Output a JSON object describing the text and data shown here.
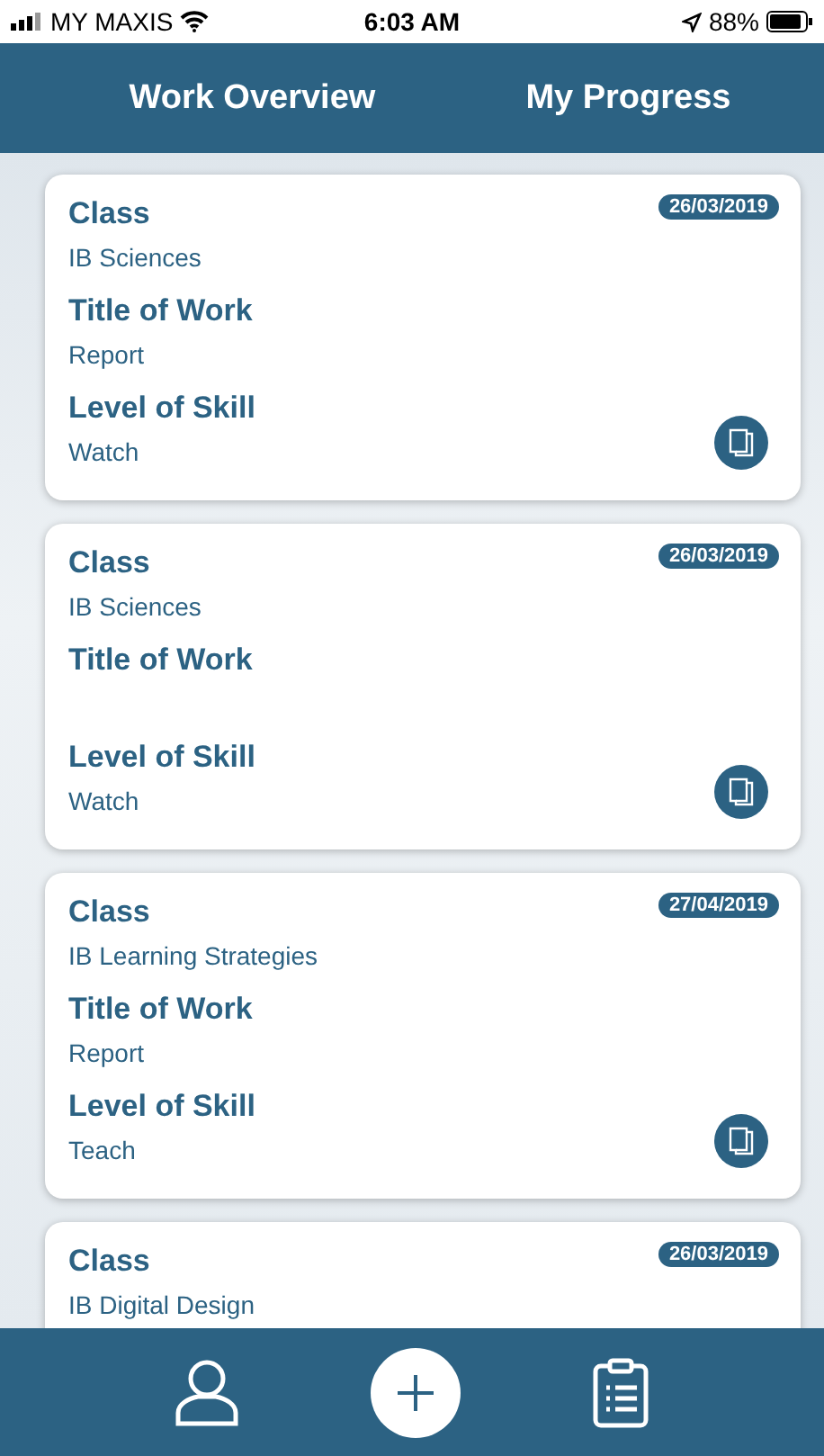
{
  "status_bar": {
    "carrier": "MY MAXIS",
    "time": "6:03 AM",
    "battery": "88%"
  },
  "tabs": [
    {
      "label": "Work Overview"
    },
    {
      "label": "My Progress"
    }
  ],
  "cards": [
    {
      "date": "26/03/2019",
      "attachment": true,
      "fields": [
        {
          "label": "Class",
          "value": "IB Sciences"
        },
        {
          "label": "Title of Work",
          "value": "Report"
        },
        {
          "label": "Level of Skill",
          "value": "Watch"
        }
      ]
    },
    {
      "date": "26/03/2019",
      "attachment": true,
      "fields": [
        {
          "label": "Class",
          "value": "IB Sciences"
        },
        {
          "label": "Title of Work"
        },
        {
          "label": "Level of Skill",
          "value": "Watch"
        }
      ]
    },
    {
      "date": "27/04/2019",
      "attachment": true,
      "fields": [
        {
          "label": "Class",
          "value": "IB Learning Strategies"
        },
        {
          "label": "Title of Work",
          "value": "Report"
        },
        {
          "label": "Level of Skill",
          "value": "Teach"
        }
      ]
    },
    {
      "date": "26/03/2019",
      "attachment": false,
      "fields": [
        {
          "label": "Class",
          "value": "IB Digital Design"
        }
      ]
    }
  ]
}
